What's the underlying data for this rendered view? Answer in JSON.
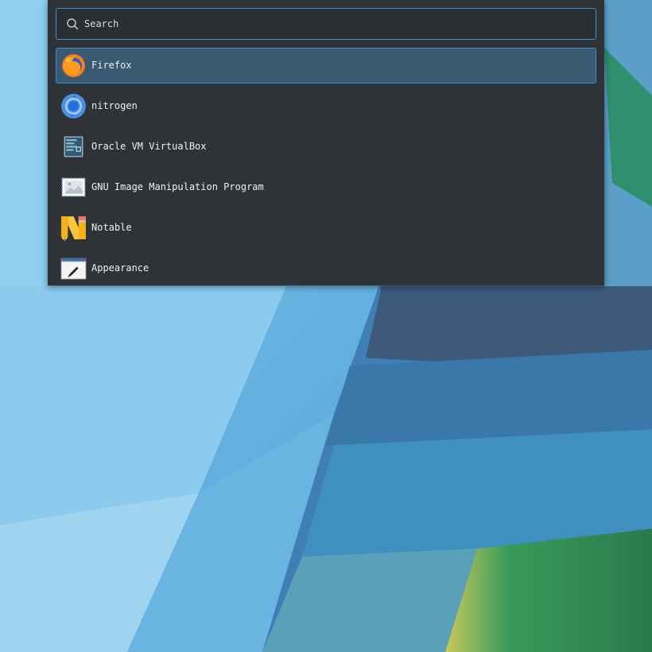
{
  "search": {
    "placeholder": "Search",
    "icon": "search-icon"
  },
  "apps": [
    {
      "label": "Firefox",
      "icon": "firefox-icon",
      "selected": true
    },
    {
      "label": "nitrogen",
      "icon": "nitrogen-icon",
      "selected": false
    },
    {
      "label": "Oracle VM VirtualBox",
      "icon": "virtualbox-icon",
      "selected": false
    },
    {
      "label": "GNU Image Manipulation Program",
      "icon": "gimp-icon",
      "selected": false
    },
    {
      "label": "Notable",
      "icon": "notable-icon",
      "selected": false
    },
    {
      "label": "Appearance",
      "icon": "appearance-icon",
      "selected": false
    }
  ],
  "colors": {
    "panel": "#2f3338",
    "accent": "#3d8fd6",
    "selection": "#3a5a72"
  }
}
